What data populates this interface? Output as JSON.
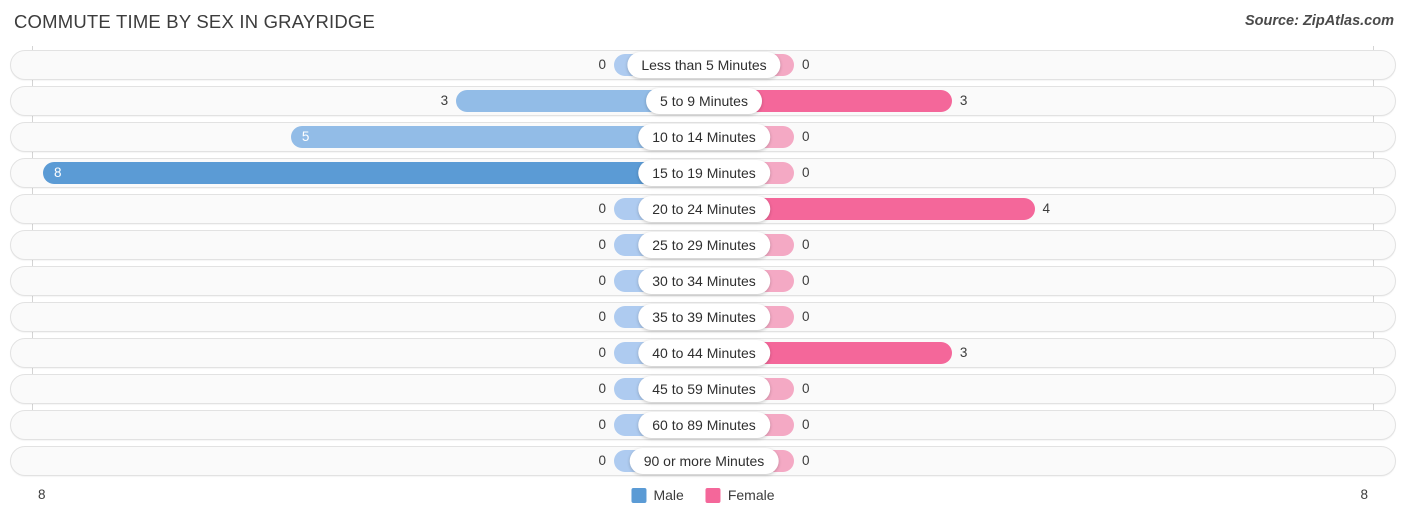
{
  "header": {
    "title": "COMMUTE TIME BY SEX IN GRAYRIDGE",
    "source": "Source: ZipAtlas.com"
  },
  "colors": {
    "male": "#5b9bd5",
    "male_light": "#92bce7",
    "male_stub": "#aecbf0",
    "female": "#f4679a",
    "female_light": "#f67fa8",
    "female_stub": "#f4a9c4",
    "track_bg": "#fafafa",
    "track_border": "#e2e2e2",
    "text": "#3c3c3c"
  },
  "axis": {
    "left_label": "8",
    "right_label": "8",
    "max": 8
  },
  "legend": {
    "items": [
      {
        "label": "Male",
        "color": "#5b9bd5"
      },
      {
        "label": "Female",
        "color": "#f4679a"
      }
    ]
  },
  "chart_data": {
    "type": "bar",
    "title": "COMMUTE TIME BY SEX IN GRAYRIDGE",
    "subtitle": "Source: ZipAtlas.com",
    "orientation": "horizontal-diverging",
    "xlabel": "",
    "ylabel": "",
    "xlim": [
      8,
      8
    ],
    "grid": false,
    "legend_position": "bottom-center",
    "categories": [
      "Less than 5 Minutes",
      "5 to 9 Minutes",
      "10 to 14 Minutes",
      "15 to 19 Minutes",
      "20 to 24 Minutes",
      "25 to 29 Minutes",
      "30 to 34 Minutes",
      "35 to 39 Minutes",
      "40 to 44 Minutes",
      "45 to 59 Minutes",
      "60 to 89 Minutes",
      "90 or more Minutes"
    ],
    "series": [
      {
        "name": "Male",
        "values": [
          0,
          3,
          5,
          8,
          0,
          0,
          0,
          0,
          0,
          0,
          0,
          0
        ]
      },
      {
        "name": "Female",
        "values": [
          0,
          3,
          0,
          0,
          4,
          0,
          0,
          0,
          3,
          0,
          0,
          0
        ]
      }
    ]
  },
  "rows": [
    {
      "label": "Less than 5 Minutes",
      "male": "0",
      "female": "0"
    },
    {
      "label": "5 to 9 Minutes",
      "male": "3",
      "female": "3"
    },
    {
      "label": "10 to 14 Minutes",
      "male": "5",
      "female": "0"
    },
    {
      "label": "15 to 19 Minutes",
      "male": "8",
      "female": "0"
    },
    {
      "label": "20 to 24 Minutes",
      "male": "0",
      "female": "4"
    },
    {
      "label": "25 to 29 Minutes",
      "male": "0",
      "female": "0"
    },
    {
      "label": "30 to 34 Minutes",
      "male": "0",
      "female": "0"
    },
    {
      "label": "35 to 39 Minutes",
      "male": "0",
      "female": "0"
    },
    {
      "label": "40 to 44 Minutes",
      "male": "0",
      "female": "3"
    },
    {
      "label": "45 to 59 Minutes",
      "male": "0",
      "female": "0"
    },
    {
      "label": "60 to 89 Minutes",
      "male": "0",
      "female": "0"
    },
    {
      "label": "90 or more Minutes",
      "male": "0",
      "female": "0"
    }
  ]
}
